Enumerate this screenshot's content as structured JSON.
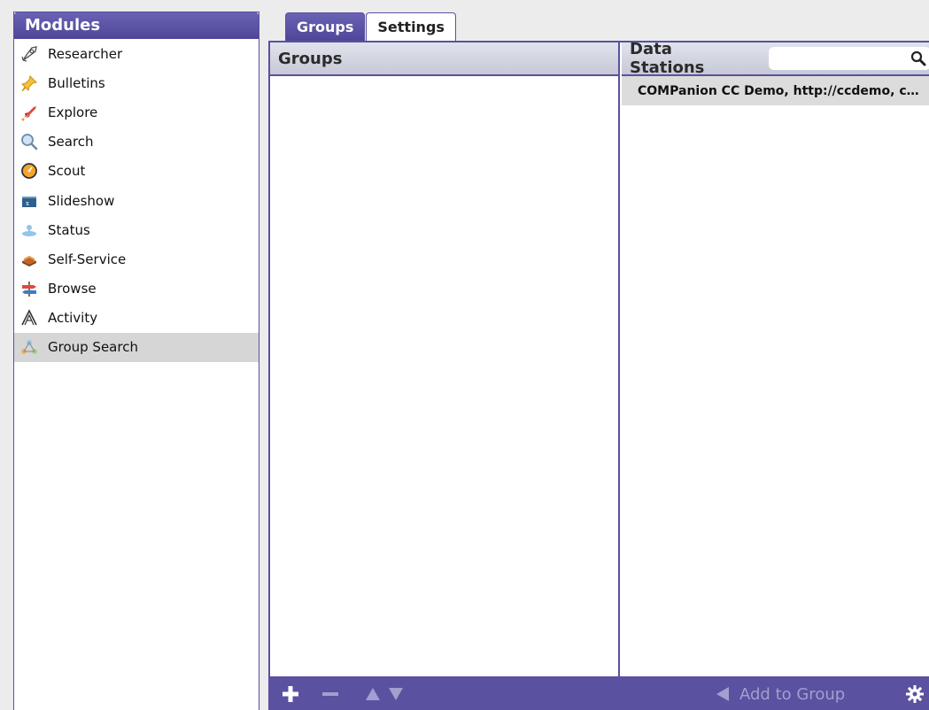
{
  "sidebar": {
    "title": "Modules",
    "items": [
      {
        "label": "Researcher",
        "icon": "rocket-outline-icon"
      },
      {
        "label": "Bulletins",
        "icon": "pushpin-icon"
      },
      {
        "label": "Explore",
        "icon": "rocket-icon"
      },
      {
        "label": "Search",
        "icon": "magnifier-icon"
      },
      {
        "label": "Scout",
        "icon": "compass-icon"
      },
      {
        "label": "Slideshow",
        "icon": "slideshow-icon"
      },
      {
        "label": "Status",
        "icon": "status-icon"
      },
      {
        "label": "Self-Service",
        "icon": "books-icon"
      },
      {
        "label": "Browse",
        "icon": "signpost-icon"
      },
      {
        "label": "Activity",
        "icon": "activity-icon"
      },
      {
        "label": "Group Search",
        "icon": "group-search-icon"
      }
    ],
    "selected_index": 10
  },
  "tabs": [
    {
      "label": "Groups",
      "active": true
    },
    {
      "label": "Settings",
      "active": false
    }
  ],
  "groups_pane": {
    "title": "Groups",
    "items": []
  },
  "stations_pane": {
    "title": "Data Stations",
    "search_value": "",
    "items": [
      "COMPanion CC Demo, http://ccdemo, c…"
    ]
  },
  "toolbar": {
    "add_to_group_label": "Add to Group"
  },
  "colors": {
    "accent": "#5a51a0",
    "header_gradient_top": "#6a62b5",
    "header_gradient_bottom": "#4e4697",
    "selected_row": "#d6d6d6",
    "disabled_text": "#a39fce"
  }
}
